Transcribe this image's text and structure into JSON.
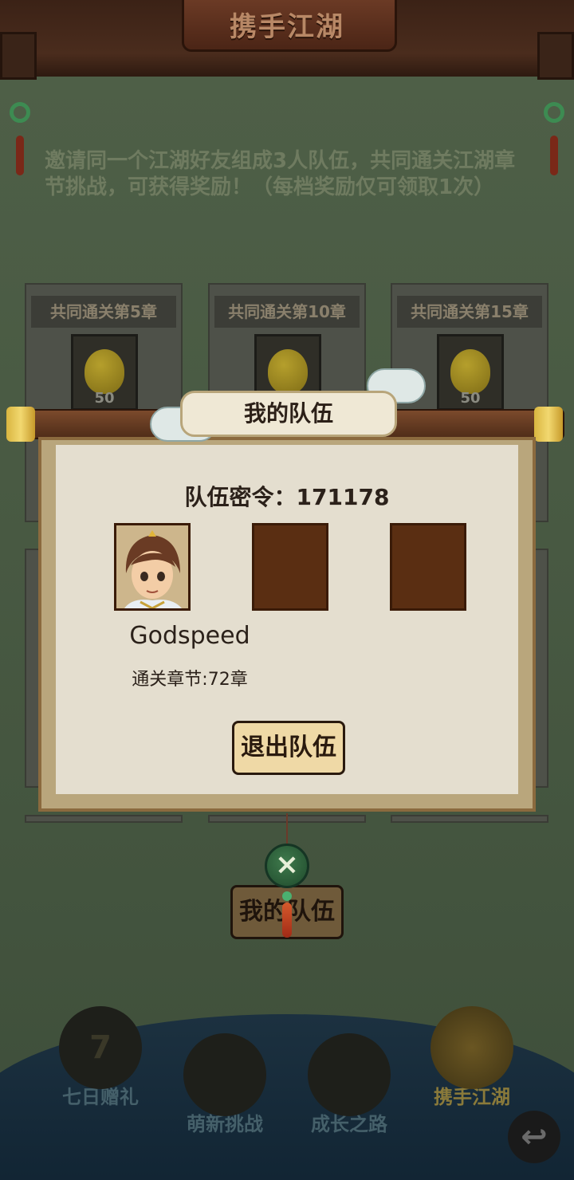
{
  "header": {
    "title": "携手江湖"
  },
  "intro": {
    "text": "邀请同一个江湖好友组成3人队伍，共同通关江湖章节挑战，可获得奖励！（每档奖励仅可领取1次）"
  },
  "reward_cards": [
    {
      "title": "共同通关第5章",
      "count": "50"
    },
    {
      "title": "共同通关第10章",
      "count": ""
    },
    {
      "title": "共同通关第15章",
      "count": "50"
    }
  ],
  "dialog": {
    "title": "我的队伍",
    "password_label": "队伍密令：171178",
    "member": {
      "name": "Godspeed",
      "chapter": "通关章节:72章"
    },
    "leave_button": "退出队伍"
  },
  "main_button": "我的队伍",
  "close_icon": "×",
  "bottom_nav": [
    {
      "label": "七日赠礼",
      "icon": "7",
      "active": false
    },
    {
      "label": "萌新挑战",
      "icon": "",
      "active": false
    },
    {
      "label": "成长之路",
      "icon": "",
      "active": false
    },
    {
      "label": "携手江湖",
      "icon": "",
      "active": true
    }
  ],
  "colors": {
    "accent": "#efd9a6",
    "nav_active": "#8a7a3a"
  }
}
